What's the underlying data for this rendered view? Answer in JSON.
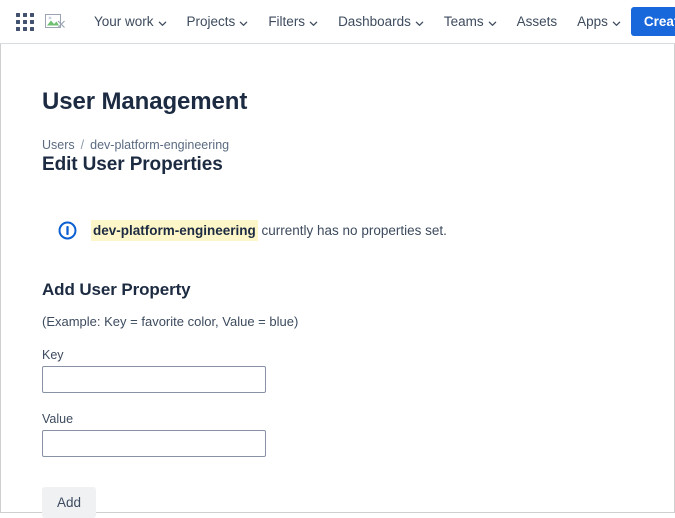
{
  "nav": {
    "app_switcher_icon": "grid-apps-icon",
    "logo_icon": "broken-image-icon",
    "items": [
      {
        "label": "Your work",
        "has_chevron": true
      },
      {
        "label": "Projects",
        "has_chevron": true
      },
      {
        "label": "Filters",
        "has_chevron": true
      },
      {
        "label": "Dashboards",
        "has_chevron": true
      },
      {
        "label": "Teams",
        "has_chevron": true
      },
      {
        "label": "Assets",
        "has_chevron": false
      },
      {
        "label": "Apps",
        "has_chevron": true
      }
    ],
    "create_label": "Create",
    "create_color": "#1868db"
  },
  "main": {
    "page_title": "User Management",
    "breadcrumb": {
      "root": "Users",
      "separator": "/",
      "current": "dev-platform-engineering"
    },
    "section_title": "Edit User Properties",
    "notice": {
      "icon": "info-circle-icon",
      "highlight": "dev-platform-engineering",
      "rest": " currently has no properties set.",
      "highlight_color": "#fdf6c8"
    },
    "form": {
      "heading": "Add User Property",
      "example": "(Example: Key = favorite color, Value = blue)",
      "key_label": "Key",
      "key_value": "",
      "key_placeholder": "",
      "value_label": "Value",
      "value_value": "",
      "value_placeholder": "",
      "submit_label": "Add"
    }
  }
}
